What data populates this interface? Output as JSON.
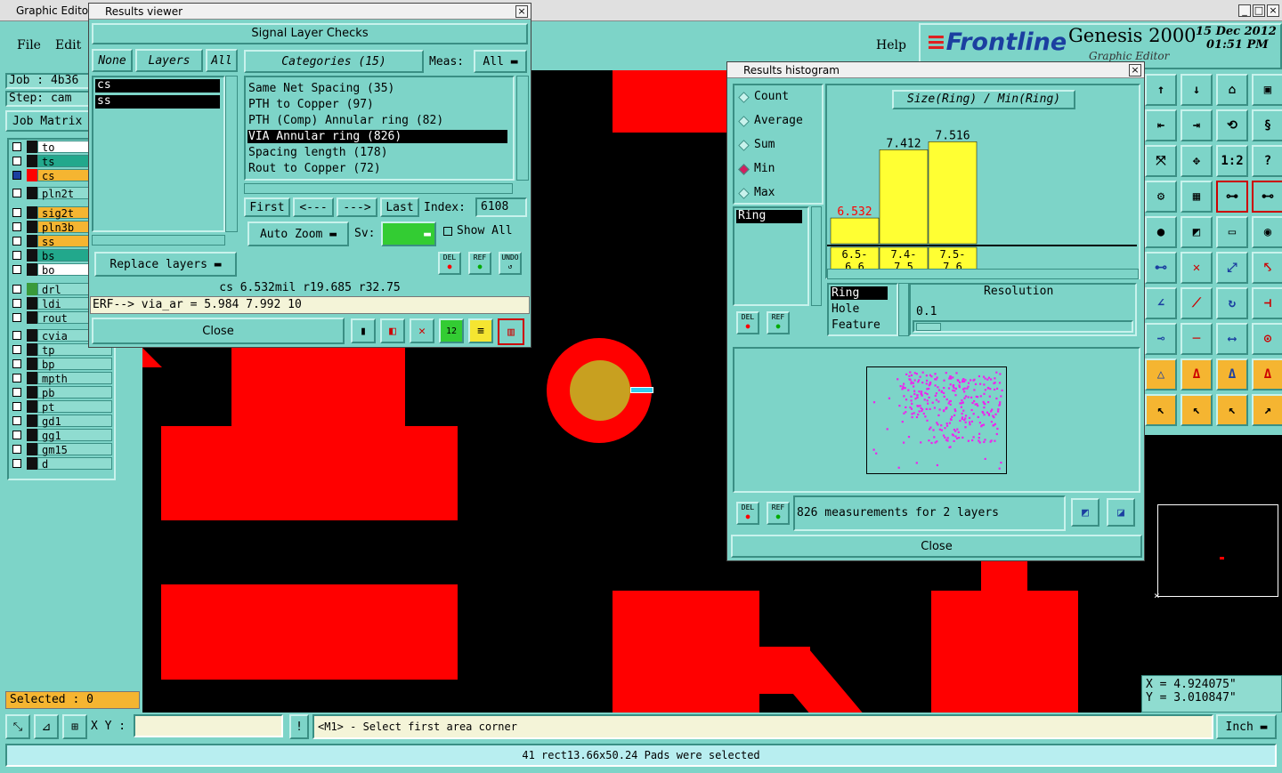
{
  "main_window": {
    "title": "Graphic Editor",
    "menu": {
      "file": "File",
      "edit": "Edit",
      "help": "Help"
    },
    "job": "Job : 4b36",
    "step": "Step: cam",
    "job_matrix": "Job Matrix",
    "brand": "Frontline",
    "product": "Genesis 2000",
    "product_sub": "Graphic Editor",
    "date": "15 Dec 2012",
    "time": "01:51 PM",
    "selected": "Selected : 0",
    "xy_label": "X Y :",
    "xy_value": "",
    "prompt": "<M1> - Select first area corner",
    "units": "Inch",
    "status": "41 rect13.66x50.24 Pads were selected",
    "coord_x": "X = 4.924075\"",
    "coord_y": "Y = 3.010847\""
  },
  "layers": [
    {
      "name": "to",
      "color": "#ffffff"
    },
    {
      "name": "ts",
      "color": "#22a88c"
    },
    {
      "name": "cs",
      "color": "#f5b531",
      "swatch": "#ff0000"
    },
    {
      "name": "pln2t",
      "color": "#8fdcd0"
    },
    {
      "name": "sig2t",
      "color": "#f5b531"
    },
    {
      "name": "pln3b",
      "color": "#f5b531"
    },
    {
      "name": "ss",
      "color": "#f5b531"
    },
    {
      "name": "bs",
      "color": "#22a88c"
    },
    {
      "name": "bo",
      "color": "#ffffff"
    },
    {
      "name": "drl",
      "color": "#8fdcd0"
    },
    {
      "name": "ldi",
      "color": "#8fdcd0"
    },
    {
      "name": "rout",
      "color": "#8fdcd0"
    },
    {
      "name": "cvia",
      "color": "#8fdcd0"
    },
    {
      "name": "tp",
      "color": "#8fdcd0"
    },
    {
      "name": "bp",
      "color": "#8fdcd0"
    },
    {
      "name": "mpth",
      "color": "#8fdcd0"
    },
    {
      "name": "pb",
      "color": "#8fdcd0"
    },
    {
      "name": "pt",
      "color": "#8fdcd0"
    },
    {
      "name": "gd1",
      "color": "#8fdcd0"
    },
    {
      "name": "gg1",
      "color": "#8fdcd0"
    },
    {
      "name": "gm15",
      "color": "#8fdcd0"
    },
    {
      "name": "d",
      "color": "#8fdcd0"
    }
  ],
  "results_viewer": {
    "title": "Results viewer",
    "header": "Signal Layer Checks",
    "none": "None",
    "layers": "Layers",
    "all": "All",
    "categories_btn": "Categories (15)",
    "meas_label": "Meas:",
    "meas_value": "All",
    "layer_list": [
      "cs",
      "ss"
    ],
    "categories": [
      "Same Net Spacing (35)",
      "PTH to Copper (97)",
      "PTH (Comp) Annular ring (82)",
      "VIA Annular ring (826)",
      "Spacing length (178)",
      "Rout to Copper (72)"
    ],
    "first": "First",
    "prev": "<---",
    "next": "--->",
    "last": "Last",
    "index_label": "Index:",
    "index_value": "6108",
    "auto_zoom": "Auto Zoom",
    "sv_label": "Sv:",
    "show_all": "Show All",
    "replace_layers": "Replace layers",
    "del": "DEL",
    "ref": "REF",
    "undo": "UNDO",
    "info": "cs 6.532mil  r19.685  r32.75",
    "erf": "ERF--> via_ar = 5.984 7.992 10",
    "close": "Close"
  },
  "histogram": {
    "title": "Results histogram",
    "modes": [
      "Count",
      "Average",
      "Sum",
      "Min",
      "Max"
    ],
    "selected_mode": "Min",
    "measure_list": [
      "Ring"
    ],
    "chart_title": "Size(Ring) / Min(Ring)",
    "bars": [
      {
        "value": "6.532",
        "range": "6.5-\n6.6",
        "color": "#ff0000"
      },
      {
        "value": "7.412",
        "range": "7.4-\n7.5",
        "color": "#000000"
      },
      {
        "value": "7.516",
        "range": "7.5-\n7.6",
        "color": "#000000"
      }
    ],
    "attr_list": [
      "Ring",
      "Hole",
      "Feature"
    ],
    "resolution_label": "Resolution",
    "resolution_value": "0.1",
    "del": "DEL",
    "ref": "REF",
    "measurements": "826 measurements for 2 layers",
    "close": "Close"
  },
  "chart_data": {
    "type": "bar",
    "title": "Size(Ring) / Min(Ring)",
    "categories": [
      "6.5-6.6",
      "7.4-7.5",
      "7.5-7.6"
    ],
    "values": [
      6.532,
      7.412,
      7.516
    ]
  }
}
